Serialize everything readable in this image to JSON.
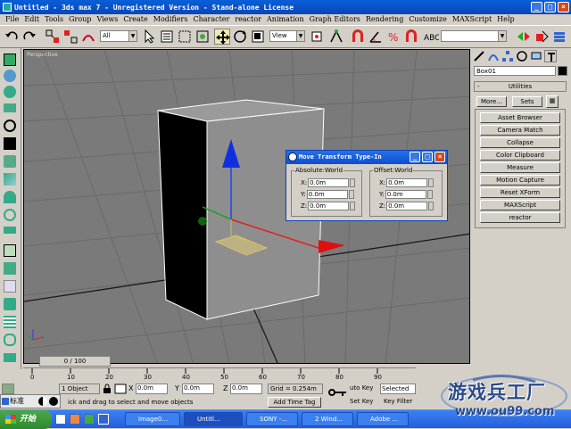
{
  "window": {
    "title": "Untitled - 3ds max 7 - Unregistered Version - Stand-alone License"
  },
  "menu": [
    "File",
    "Edit",
    "Tools",
    "Group",
    "Views",
    "Create",
    "Modifiers",
    "Character",
    "reactor",
    "Animation",
    "Graph Editors",
    "Rendering",
    "Customize",
    "MAXScript",
    "Help"
  ],
  "toolbar": {
    "selection_filter": "All",
    "ref_coord": "View",
    "named_sel": ""
  },
  "viewport": {
    "label": "Perspective"
  },
  "panel": {
    "object_name": "Box01",
    "rollout": "Utilities",
    "more_btn": "More...",
    "sets_btn": "Sets",
    "utilities": [
      "Asset Browser",
      "Camera Match",
      "Collapse",
      "Color Clipboard",
      "Measure",
      "Motion Capture",
      "Reset XForm",
      "MAXScript",
      "reactor"
    ]
  },
  "dialog": {
    "title": "Move Transform Type-In",
    "absolute_label": "Absolute:World",
    "offset_label": "Offset:World",
    "absolute": [
      {
        "axis": "X:",
        "value": "0.0m"
      },
      {
        "axis": "Y:",
        "value": "0.0m"
      },
      {
        "axis": "Z:",
        "value": "0.0m"
      }
    ],
    "offset": [
      {
        "axis": "X:",
        "value": "0.0m"
      },
      {
        "axis": "Y:",
        "value": "0.0m"
      },
      {
        "axis": "Z:",
        "value": "0.0m"
      }
    ]
  },
  "timeline": {
    "slider": "0 / 100",
    "ticks": [
      "0",
      "10",
      "20",
      "30",
      "40",
      "50",
      "60",
      "70",
      "80",
      "90"
    ]
  },
  "status": {
    "selection": "1 Object",
    "x_label": "X",
    "x": "0.0m",
    "y_label": "Y",
    "y": "0.0m",
    "z_label": "Z",
    "z": "0.0m",
    "grid": "Grid = 0.254m",
    "prompt": "ick and drag to select and move objects",
    "add_time_tag": "Add Time Tag",
    "auto_key": "uto Key",
    "set_key": "Set Key",
    "selected": "Selected",
    "key_filters": "Key Filter"
  },
  "ime": {
    "label": "标准"
  },
  "taskbar": {
    "start": "开始",
    "tasks": [
      "Image0...",
      "Untitl...",
      "SONY -...",
      "2 Wind...",
      "Adobe ..."
    ]
  },
  "watermark": {
    "text": "游戏兵工厂",
    "url": "www.ou99.com"
  }
}
